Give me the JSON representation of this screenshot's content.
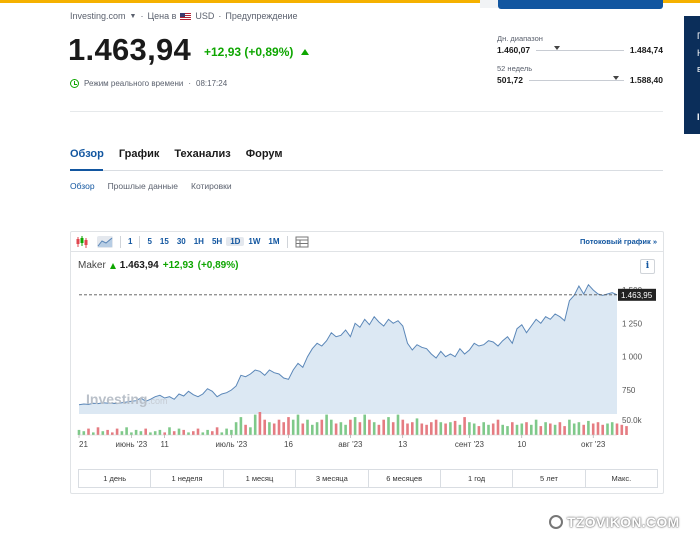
{
  "header": {
    "site": "Investing.com",
    "price_in_label": "Цена в",
    "currency": "USD",
    "warning": "Предупреждение",
    "price": "1.463,94",
    "change": "+12,93 (+0,89%)",
    "realtime_label": "Режим реального времени",
    "time": "08:17:24"
  },
  "ranges": {
    "day": {
      "label": "Дн. диапазон",
      "low": "1.460,07",
      "high": "1.484,74",
      "marker_fraction": 0.2
    },
    "week52": {
      "label": "52 недель",
      "low": "501,72",
      "high": "1.588,40",
      "marker_fraction": 0.88
    }
  },
  "tabs": [
    "Обзор",
    "График",
    "Теханализ",
    "Форум"
  ],
  "subtabs": [
    "Обзор",
    "Прошлые данные",
    "Котировки"
  ],
  "toolbar": {
    "intervals": [
      "1",
      "5",
      "15",
      "30",
      "1H",
      "5H",
      "1D",
      "1W",
      "1M"
    ],
    "selected": "1D",
    "stream_label": "Потоковый график",
    "stream_arrow": "»"
  },
  "legend": {
    "name": "Maker",
    "value": "1.463,94",
    "change": "+12,93",
    "pct": "(+0,89%)",
    "info": "i"
  },
  "chart_data": {
    "type": "area",
    "y_ticks": [
      1250,
      1000,
      750
    ],
    "y_tick_labels": [
      "1 250",
      "1 000",
      "750"
    ],
    "top_tick_label": "1 500",
    "volume_label": "50.0k",
    "current_label": "1.463,95",
    "current_value": 1463.95,
    "ylim": [
      570,
      1560
    ],
    "x_tick_labels": [
      "21",
      "июнь '23",
      "11",
      "июль '23",
      "16",
      "авг '23",
      "13",
      "сент '23",
      "10",
      "окт '23"
    ],
    "x_tick_index": [
      0,
      11,
      18,
      32,
      44,
      57,
      68,
      82,
      93,
      108
    ],
    "values": [
      640,
      645,
      642,
      650,
      648,
      655,
      652,
      650,
      648,
      655,
      660,
      665,
      670,
      690,
      665,
      680,
      700,
      710,
      690,
      700,
      680,
      720,
      705,
      740,
      715,
      700,
      720,
      760,
      740,
      700,
      720,
      730,
      750,
      780,
      860,
      850,
      870,
      900,
      890,
      860,
      900,
      880,
      870,
      840,
      830,
      900,
      950,
      920,
      1000,
      1060,
      1100,
      1080,
      1120,
      1180,
      1150,
      1160,
      1200,
      1150,
      1250,
      1220,
      1280,
      1240,
      1300,
      1260,
      1230,
      1280,
      1250,
      1270,
      1230,
      1100,
      1050,
      1090,
      1070,
      1060,
      1020,
      990,
      1040,
      1000,
      1020,
      1000,
      1060,
      1020,
      1050,
      1100,
      1080,
      1090,
      1120,
      1110,
      1080,
      1120,
      1150,
      1100,
      1210,
      1240,
      1180,
      1230,
      1280,
      1250,
      1300,
      1280,
      1320,
      1300,
      1270,
      1420,
      1460,
      1530,
      1470,
      1540,
      1500,
      1470,
      1460,
      1470,
      1480,
      1464
    ],
    "volumes": [
      4,
      3,
      5,
      2,
      6,
      3,
      4,
      2,
      5,
      3,
      6,
      2,
      4,
      3,
      5,
      2,
      3,
      4,
      2,
      6,
      3,
      5,
      4,
      2,
      3,
      5,
      2,
      4,
      3,
      6,
      2,
      5,
      4,
      10,
      14,
      8,
      6,
      16,
      18,
      12,
      10,
      9,
      12,
      10,
      14,
      12,
      16,
      9,
      12,
      8,
      10,
      12,
      16,
      12,
      9,
      10,
      8,
      12,
      14,
      10,
      16,
      12,
      10,
      8,
      12,
      14,
      10,
      16,
      12,
      9,
      10,
      13,
      9,
      8,
      10,
      12,
      10,
      9,
      10,
      11,
      8,
      14,
      10,
      9,
      7,
      10,
      8,
      9,
      12,
      8,
      7,
      10,
      8,
      9,
      10,
      8,
      12,
      7,
      10,
      9,
      8,
      10,
      7,
      12,
      9,
      10,
      8,
      11,
      9,
      10,
      8,
      9,
      10,
      9,
      8,
      7
    ],
    "volume_colors": "mixed green/red",
    "grid": false
  },
  "periods": [
    "1 день",
    "1 неделя",
    "1 месяц",
    "3 месяца",
    "6 месяцев",
    "1 год",
    "5 лет",
    "Макс."
  ],
  "colors": {
    "accent": "#1256a0",
    "up": "#0ea600",
    "down": "#e0464e",
    "area_fill": "#dce8f3",
    "line": "#5b87b8"
  },
  "watermark": "TZOVIKON.COM"
}
